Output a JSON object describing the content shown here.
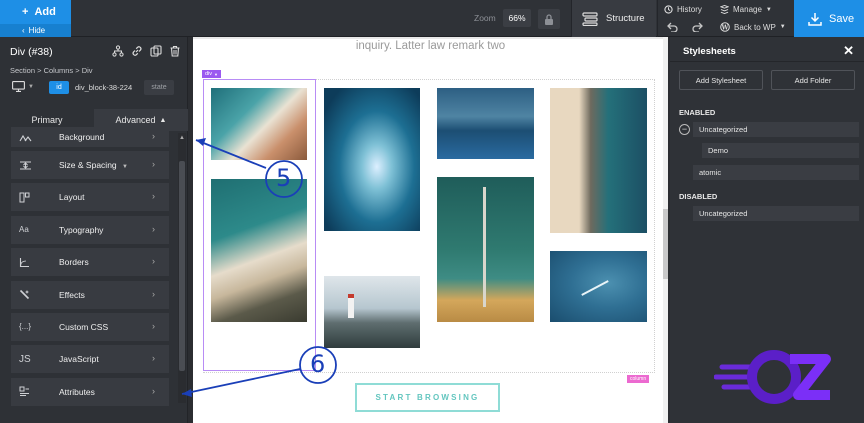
{
  "topbar": {
    "add_label": "Add",
    "hide_label": "Hide",
    "zoom_label": "Zoom",
    "zoom_value": "66%",
    "structure_label": "Structure",
    "history_label": "History",
    "manage_label": "Manage",
    "back_to_wp_label": "Back to WP",
    "save_label": "Save"
  },
  "left_panel": {
    "element_title": "Div (#38)",
    "breadcrumb": "Section > Columns > Div",
    "id_badge": "id",
    "selector_text": "div_block-38-224",
    "state_label": "state",
    "tabs": [
      {
        "label": "Primary",
        "active": false
      },
      {
        "label": "Advanced",
        "active": true
      }
    ],
    "menu": [
      {
        "label": "Background",
        "icon": "background-icon"
      },
      {
        "label": "Size & Spacing",
        "icon": "size-spacing-icon"
      },
      {
        "label": "Layout",
        "icon": "layout-icon"
      },
      {
        "label": "Typography",
        "icon": "typography-icon",
        "glyph": "Aa"
      },
      {
        "label": "Borders",
        "icon": "borders-icon"
      },
      {
        "label": "Effects",
        "icon": "effects-icon"
      },
      {
        "label": "Custom CSS",
        "icon": "custom-css-icon",
        "glyph": "{...}"
      },
      {
        "label": "JavaScript",
        "icon": "javascript-icon",
        "glyph": "JS"
      },
      {
        "label": "Attributes",
        "icon": "attributes-icon"
      }
    ]
  },
  "canvas": {
    "top_text": "inquiry. Latter law remark two",
    "div_tag": "div",
    "column_tag": "column",
    "browse_button": "START BROWSING"
  },
  "right_panel": {
    "title": "Stylesheets",
    "add_stylesheet": "Add Stylesheet",
    "add_folder": "Add Folder",
    "enabled_label": "ENABLED",
    "disabled_label": "DISABLED",
    "enabled_items": [
      "Uncategorized",
      "Demo",
      "atomic"
    ],
    "disabled_items": [
      "Uncategorized"
    ]
  },
  "annotations": {
    "step_5": "5",
    "step_6": "6"
  },
  "colors": {
    "accent_blue": "#1e8fe6",
    "selection_purple": "#9b59f0",
    "annotation_blue": "#1a3fb8",
    "browse_teal": "#63c6bf",
    "logo_purple": "#7b2ff7"
  }
}
